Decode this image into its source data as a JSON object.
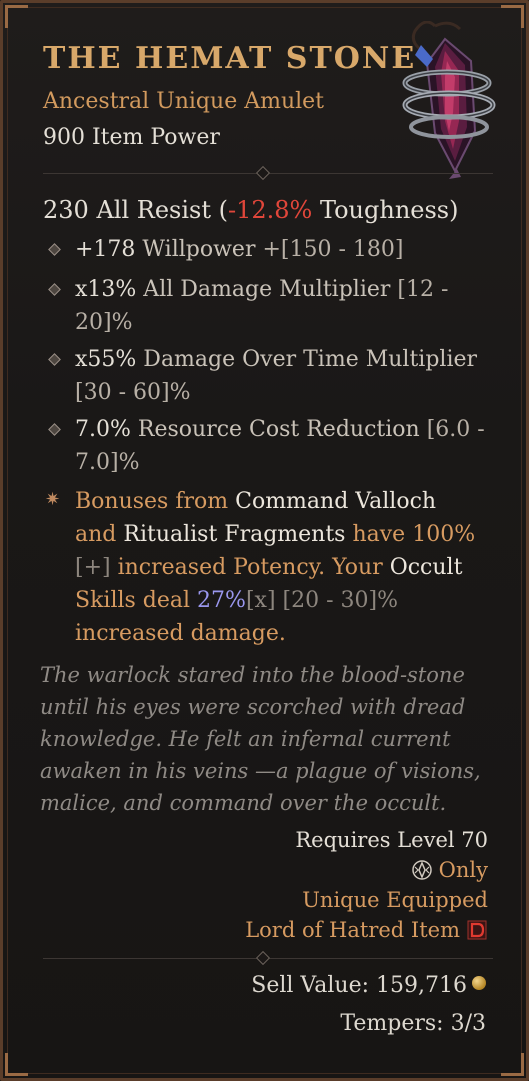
{
  "item": {
    "name": "THE HEMAT STONE",
    "type": "Ancestral Unique Amulet",
    "power": "900 Item Power"
  },
  "resist": {
    "base": "230 All Resist (",
    "toughness": "-12.8%",
    "tail": " Toughness)"
  },
  "affixes": [
    {
      "value": "+178",
      "name": " Willpower ",
      "range": "+[150 - 180]"
    },
    {
      "value": "x13%",
      "name": " All Damage Multiplier ",
      "range": "[12 - 20]%"
    },
    {
      "value": "x55%",
      "name": " Damage Over Time Multiplier ",
      "range": "[30 - 60]%"
    },
    {
      "value": "7.0%",
      "name": " Resource Cost Reduction ",
      "range": "[6.0 - 7.0]%"
    }
  ],
  "unique": {
    "p1": "Bonuses from ",
    "w1": "Command Valloch",
    "p2": " and ",
    "w2": "Ritualist Fragments",
    "p3": " have ",
    "v1": "100%",
    "g1": "[+]",
    "p4": " increased Potency. Your ",
    "w3": "Occult",
    "p5": " Skills deal ",
    "v2": "27%",
    "g2": "[x]",
    "g3": " [20 - 30]%",
    "p6": " increased damage."
  },
  "flavor": "The warlock stared into the blood-stone until his eyes were scorched with dread knowledge. He felt an infernal current awaken in his veins —a plague of visions, malice, and command over the occult.",
  "requirements": {
    "level": "Requires Level 70",
    "class_only": "Only",
    "equipped": "Unique Equipped",
    "expansion": "Lord of Hatred Item"
  },
  "footer": {
    "sell_value": "Sell Value: 159,716",
    "tempers": "Tempers: 3/3"
  },
  "icons": [
    "amulet-image",
    "diamond-bullet-icon",
    "unique-star-icon",
    "class-icon",
    "expansion-d-icon",
    "gold-coin-icon"
  ],
  "colors": {
    "title": "#d8a86a",
    "unique": "#d79b61",
    "negative": "#e0463a",
    "legendary_value": "#9a97ee"
  }
}
